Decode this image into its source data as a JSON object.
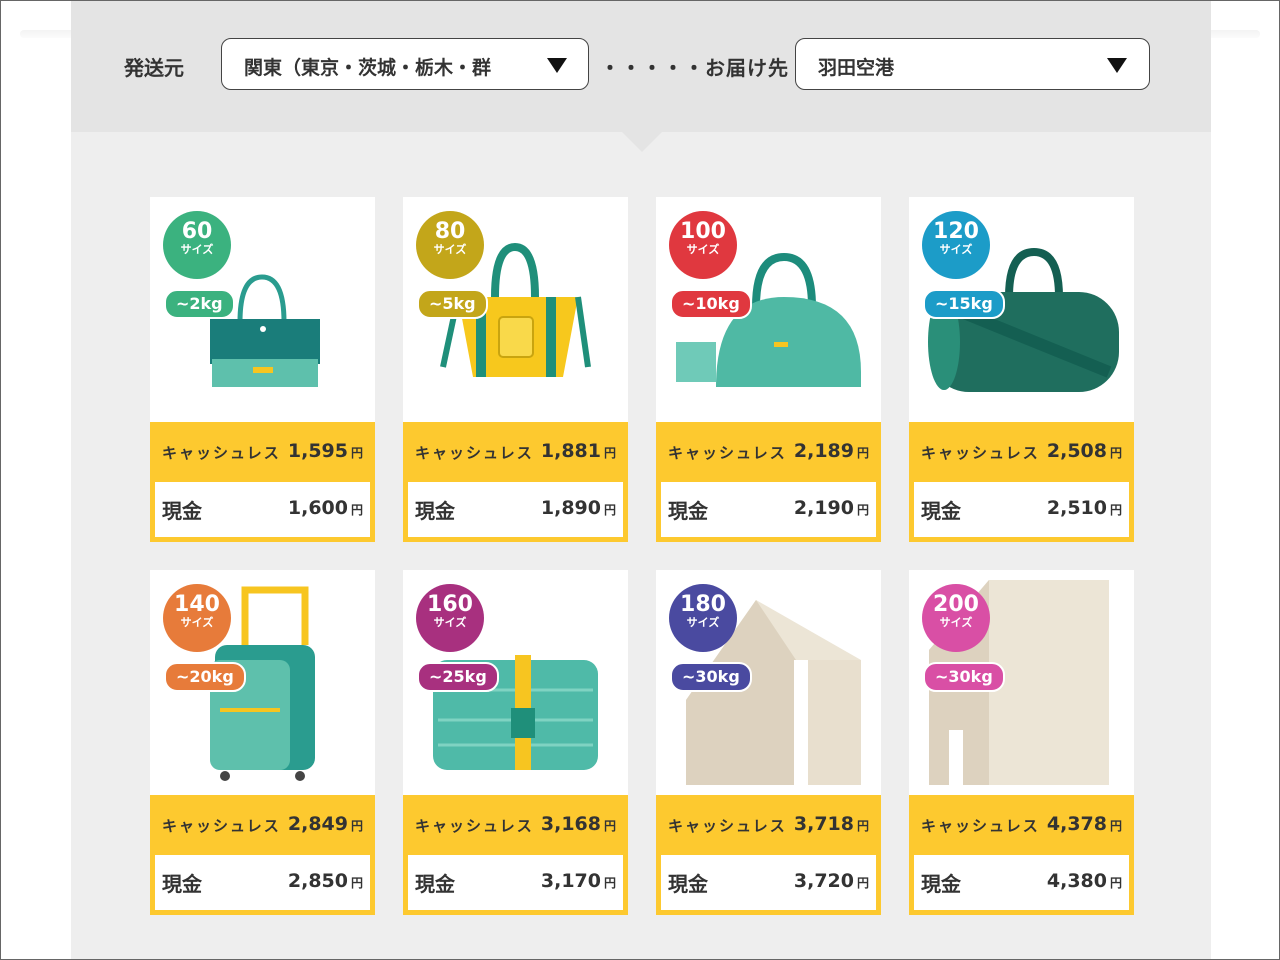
{
  "selector": {
    "origin_label": "発送元",
    "origin_value": "関東（東京・茨城・栃木・群",
    "connector": "・・・・・",
    "destination_label": "お届け先",
    "destination_value": "羽田空港"
  },
  "labels": {
    "cashless": "キャッシュレス",
    "cash": "現金",
    "yen": "円",
    "size_unit": "サイズ"
  },
  "cards": [
    {
      "size": "60",
      "weight": "~2kg",
      "cashless_price": "1,595",
      "cash_price": "1,600",
      "color": "#3bb27f",
      "icon": "tote-bag-icon"
    },
    {
      "size": "80",
      "weight": "~5kg",
      "cashless_price": "1,881",
      "cash_price": "1,890",
      "color": "#c3a61a",
      "icon": "yellow-tote-bag-icon"
    },
    {
      "size": "100",
      "weight": "~10kg",
      "cashless_price": "2,189",
      "cash_price": "2,190",
      "color": "#e0383f",
      "icon": "duffel-bag-icon"
    },
    {
      "size": "120",
      "weight": "~15kg",
      "cashless_price": "2,508",
      "cash_price": "2,510",
      "color": "#1c9cc8",
      "icon": "boston-bag-icon"
    },
    {
      "size": "140",
      "weight": "~20kg",
      "cashless_price": "2,849",
      "cash_price": "2,850",
      "color": "#e77b3a",
      "icon": "suitcase-icon"
    },
    {
      "size": "160",
      "weight": "~25kg",
      "cashless_price": "3,168",
      "cash_price": "3,170",
      "color": "#a8307f",
      "icon": "large-suitcase-icon"
    },
    {
      "size": "180",
      "weight": "~30kg",
      "cashless_price": "3,718",
      "cash_price": "3,720",
      "color": "#4a4aa0",
      "icon": "cardboard-box-icon"
    },
    {
      "size": "200",
      "weight": "~30kg",
      "cashless_price": "4,378",
      "cash_price": "4,380",
      "color": "#d94fa5",
      "icon": "large-box-icon"
    }
  ]
}
